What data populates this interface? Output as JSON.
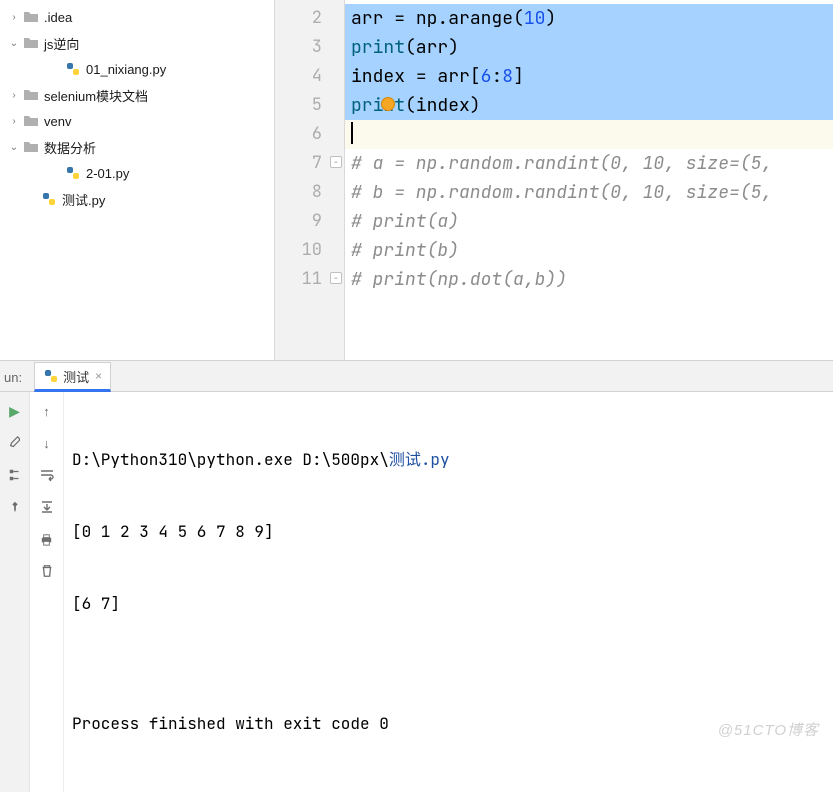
{
  "sidebar": {
    "items": [
      {
        "label": ".idea",
        "type": "folder",
        "arrow": "right",
        "indent": 0
      },
      {
        "label": "js逆向",
        "type": "folder",
        "arrow": "down",
        "indent": 0
      },
      {
        "label": "01_nixiang.py",
        "type": "py",
        "arrow": "",
        "indent": 2
      },
      {
        "label": "selenium模块文档",
        "type": "folder",
        "arrow": "right",
        "indent": 0
      },
      {
        "label": "venv",
        "type": "folder",
        "arrow": "right",
        "indent": 0
      },
      {
        "label": "数据分析",
        "type": "folder",
        "arrow": "down",
        "indent": 0
      },
      {
        "label": "2-01.py",
        "type": "py",
        "arrow": "",
        "indent": 2
      },
      {
        "label": "测试.py",
        "type": "py",
        "arrow": "",
        "indent": 1
      }
    ]
  },
  "editor": {
    "lines": [
      {
        "num": "2",
        "sel": true,
        "segs": [
          {
            "t": "arr ",
            "c": "tk-id"
          },
          {
            "t": "=",
            "c": "tk-op"
          },
          {
            "t": " np",
            "c": "tk-id"
          },
          {
            "t": ".",
            "c": "tk-op"
          },
          {
            "t": "arange",
            "c": "tk-fn"
          },
          {
            "t": "(",
            "c": "tk-op"
          },
          {
            "t": "10",
            "c": "tk-num"
          },
          {
            "t": ")",
            "c": "tk-op"
          }
        ]
      },
      {
        "num": "3",
        "sel": true,
        "segs": [
          {
            "t": "print",
            "c": "tk-call"
          },
          {
            "t": "(arr)",
            "c": "tk-op"
          }
        ]
      },
      {
        "num": "4",
        "sel": true,
        "segs": [
          {
            "t": "index ",
            "c": "tk-id"
          },
          {
            "t": "=",
            "c": "tk-op"
          },
          {
            "t": " arr[",
            "c": "tk-id"
          },
          {
            "t": "6",
            "c": "tk-num"
          },
          {
            "t": ":",
            "c": "tk-op"
          },
          {
            "t": "8",
            "c": "tk-num"
          },
          {
            "t": "]",
            "c": "tk-op"
          }
        ]
      },
      {
        "num": "5",
        "sel": true,
        "bulb": true,
        "segs": [
          {
            "t": "print",
            "c": "tk-call"
          },
          {
            "t": "(index)",
            "c": "tk-op"
          }
        ]
      },
      {
        "num": "6",
        "cur": true,
        "caret": true,
        "segs": []
      },
      {
        "num": "7",
        "fold": true,
        "segs": [
          {
            "t": "# a = np.random.randint(0, 10, size=(5,",
            "c": "tk-cmt"
          }
        ]
      },
      {
        "num": "8",
        "segs": [
          {
            "t": "# b = np.random.randint(0, 10, size=(5,",
            "c": "tk-cmt"
          }
        ]
      },
      {
        "num": "9",
        "segs": [
          {
            "t": "# print(a)",
            "c": "tk-cmt"
          }
        ]
      },
      {
        "num": "10",
        "segs": [
          {
            "t": "# print(b)",
            "c": "tk-cmt"
          }
        ]
      },
      {
        "num": "11",
        "fold": true,
        "segs": [
          {
            "t": "# print(np.dot(a,b))",
            "c": "tk-cmt"
          }
        ]
      }
    ]
  },
  "run": {
    "panel_label": "un:",
    "tab_label": "测试",
    "output": {
      "cmd_prefix": "D:\\Python310\\python.exe D:\\500px\\",
      "cmd_file": "测试.py",
      "line1": "[0 1 2 3 4 5 6 7 8 9]",
      "line2": "[6 7]",
      "line3": "",
      "line4": "Process finished with exit code 0"
    }
  },
  "watermark": "@51CTO博客"
}
